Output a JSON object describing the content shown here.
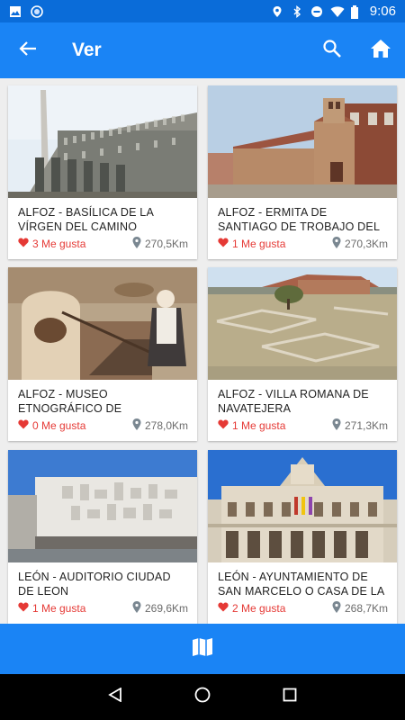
{
  "status_bar": {
    "time": "9:06",
    "icons": [
      "image-icon",
      "circle-icon",
      "location-icon",
      "bluetooth-icon",
      "do-not-disturb-icon",
      "wifi-icon",
      "battery-icon"
    ]
  },
  "app_bar": {
    "title": "Ver",
    "back_icon": "arrow-back-icon",
    "search_icon": "search-icon",
    "home_icon": "home-icon"
  },
  "cards": [
    {
      "title": "ALFOZ - BASÍLICA DE LA VÍRGEN DEL CAMINO",
      "likes": "3 Me gusta",
      "distance": "270,5Km"
    },
    {
      "title": "ALFOZ - ERMITA DE SANTIAGO DE TROBAJO DEL CAMINO",
      "likes": "1 Me gusta",
      "distance": "270,3Km"
    },
    {
      "title": "ALFOZ - MUSEO ETNOGRÁFICO DE LORENZANA",
      "likes": "0 Me gusta",
      "distance": "278,0Km"
    },
    {
      "title": "ALFOZ - VILLA ROMANA DE NAVATEJERA",
      "likes": "1 Me gusta",
      "distance": "271,3Km"
    },
    {
      "title": "LEÓN - AUDITORIO CIUDAD DE LEON",
      "likes": "1 Me gusta",
      "distance": "269,6Km"
    },
    {
      "title": "LEÓN - AYUNTAMIENTO DE SAN MARCELO O CASA DE LA",
      "likes": "2 Me gusta",
      "distance": "268,7Km"
    }
  ],
  "bottom_bar": {
    "icon": "map-icon"
  },
  "nav_bar": {
    "icons": [
      "back-triangle-icon",
      "home-circle-icon",
      "recents-square-icon"
    ]
  },
  "colors": {
    "primary": "#1a84f5",
    "status": "#0a6cd9",
    "like": "#e53935",
    "meta": "#6b6b6b"
  }
}
